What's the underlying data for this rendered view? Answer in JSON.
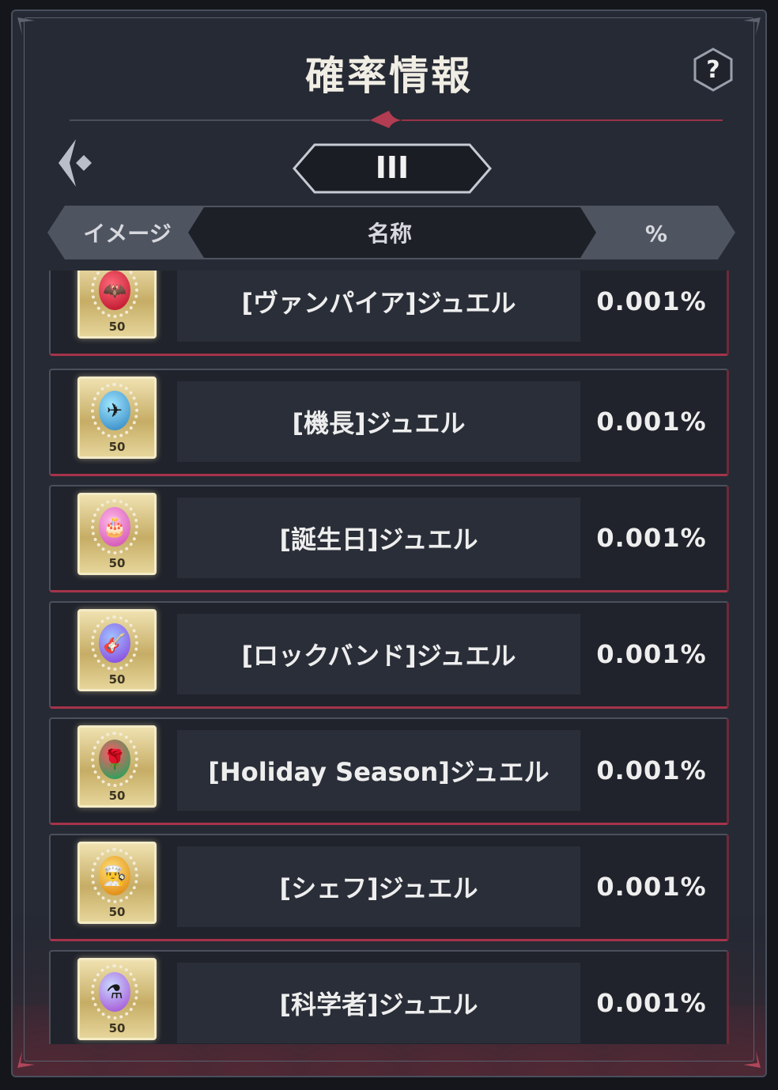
{
  "title": "確率情報",
  "help_label": "?",
  "tier_label": "III",
  "columns": {
    "image": "イメージ",
    "name": "名称",
    "percent": "%"
  },
  "items": [
    {
      "name": "[ヴァンパイア]ジュエル",
      "percent": "0.001%",
      "qty": "50",
      "icon": "bat-icon",
      "glyph": "🦇",
      "gem_colors": [
        "#ff6a7a",
        "#c0182f"
      ]
    },
    {
      "name": "[機長]ジュエル",
      "percent": "0.001%",
      "qty": "50",
      "icon": "airplane-icon",
      "glyph": "✈",
      "gem_colors": [
        "#9fe6ff",
        "#3b8fc8"
      ]
    },
    {
      "name": "[誕生日]ジュエル",
      "percent": "0.001%",
      "qty": "50",
      "icon": "cake-icon",
      "glyph": "🎂",
      "gem_colors": [
        "#ffb7e8",
        "#d457b6"
      ]
    },
    {
      "name": "[ロックバンド]ジュエル",
      "percent": "0.001%",
      "qty": "50",
      "icon": "guitar-icon",
      "glyph": "🎸",
      "gem_colors": [
        "#9fc3ff",
        "#8a4de0"
      ]
    },
    {
      "name": "[Holiday Season]ジュエル",
      "percent": "0.001%",
      "qty": "50",
      "icon": "rose-icon",
      "glyph": "🌹",
      "gem_colors": [
        "#ff5a66",
        "#27a35c"
      ]
    },
    {
      "name": "[シェフ]ジュエル",
      "percent": "0.001%",
      "qty": "50",
      "icon": "chef-hat-icon",
      "glyph": "👨‍🍳",
      "gem_colors": [
        "#ffe27a",
        "#e08a12"
      ]
    },
    {
      "name": "[科学者]ジュエル",
      "percent": "0.001%",
      "qty": "50",
      "icon": "flask-icon",
      "glyph": "⚗",
      "gem_colors": [
        "#c8d9ff",
        "#a75ad8"
      ]
    }
  ],
  "colors": {
    "accent": "#a5334a",
    "panel": "#262a34",
    "row": "#20232b"
  }
}
